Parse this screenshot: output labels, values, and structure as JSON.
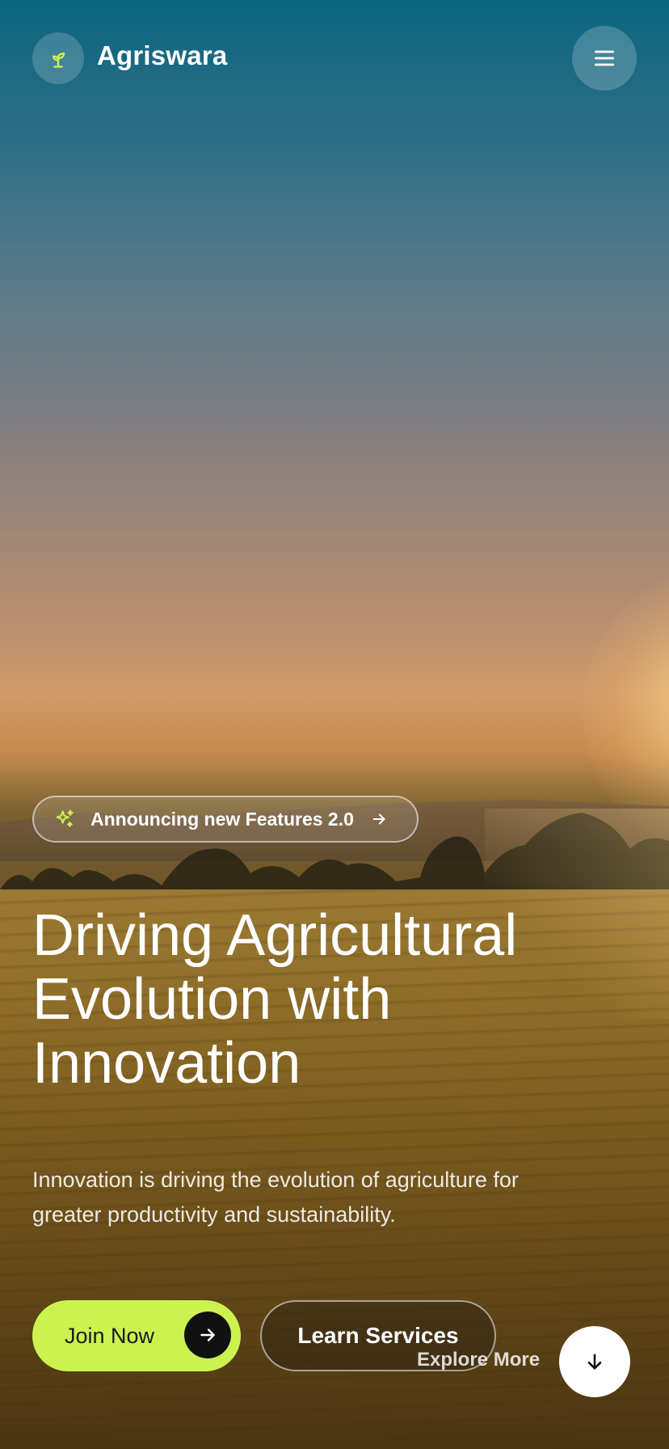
{
  "brand": {
    "name": "Agriswara",
    "logo_icon": "sprout-icon",
    "accent_color": "#ccf24f"
  },
  "header": {
    "menu_icon": "hamburger-menu-icon"
  },
  "announcement": {
    "icon": "sparkles-icon",
    "label": "Announcing new Features 2.0",
    "arrow_icon": "arrow-right-icon"
  },
  "hero": {
    "headline_line1": "Driving Agricultural",
    "headline_line2": "Evolution with",
    "headline_line3": "Innovation",
    "subtext_line1": "Innovation is driving the evolution of agriculture for",
    "subtext_line2": "greater productivity and sustainability."
  },
  "actions": {
    "join_label": "Join Now",
    "join_icon": "arrow-right-icon",
    "learn_label": "Learn Services",
    "explore_label": "Explore More",
    "explore_icon": "arrow-down-icon"
  }
}
